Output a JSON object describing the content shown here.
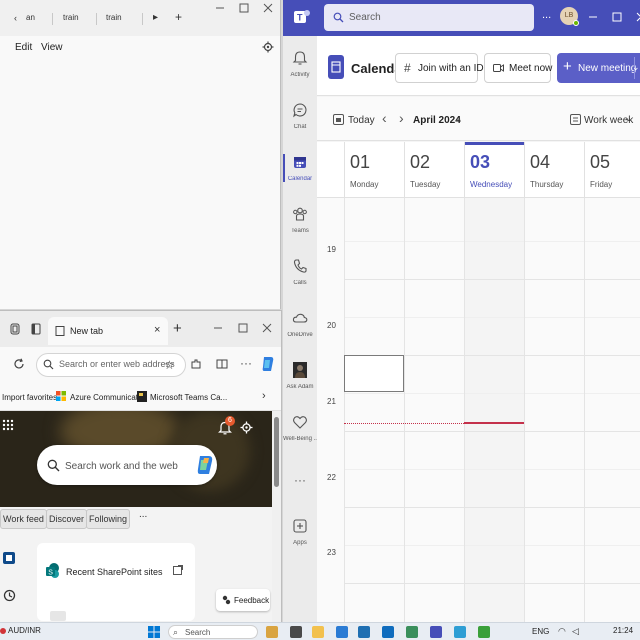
{
  "explorer_window": {
    "tabs": [
      {
        "label": "an",
        "icon": "chevron-left-icon"
      },
      {
        "label": "train"
      },
      {
        "label": "train"
      }
    ],
    "overflow_icon": "chevron-right-icon",
    "add_tab_icon": "plus-icon",
    "window_controls": [
      "minimize-icon",
      "maximize-icon",
      "close-icon"
    ],
    "menu": [
      "Edit",
      "View"
    ],
    "settings_icon": "gear-icon"
  },
  "browser_window": {
    "tab_label": "New tab",
    "address_placeholder": "Search or enter web address",
    "favorites": [
      "Import favorites",
      "Azure Communicati...",
      "Microsoft Teams Ca..."
    ],
    "notification_count": "6",
    "search_placeholder": "Search work and the web",
    "feed_tabs": [
      "Work feed",
      "Discover",
      "Following"
    ],
    "more_label": "...",
    "card_title": "Recent SharePoint sites",
    "feedback_label": "Feedback"
  },
  "teams": {
    "search_placeholder": "Search",
    "more_label": "...",
    "avatar_initials": "LB",
    "rail": [
      {
        "label": "Activity",
        "icon": "bell-icon"
      },
      {
        "label": "Chat",
        "icon": "chat-icon"
      },
      {
        "label": "Calendar",
        "icon": "calendar-icon",
        "active": true
      },
      {
        "label": "Teams",
        "icon": "teams-icon"
      },
      {
        "label": "Calls",
        "icon": "phone-icon"
      },
      {
        "label": "OneDrive",
        "icon": "cloud-icon"
      },
      {
        "label": "Ask Adam",
        "icon": "person-icon"
      },
      {
        "label": "Well-Being ...",
        "icon": "heart-icon"
      },
      {
        "label": "...",
        "icon": "more-icon"
      },
      {
        "label": "Apps",
        "icon": "plus-box-icon"
      }
    ],
    "calendar_title": "Calendar",
    "join_label": "Join with an ID",
    "meet_label": "Meet now",
    "new_meeting_label": "New meeting",
    "today_label": "Today",
    "month_label": "April 2024",
    "view_label": "Work week",
    "days": [
      {
        "num": "01",
        "name": "Monday"
      },
      {
        "num": "02",
        "name": "Tuesday"
      },
      {
        "num": "03",
        "name": "Wednesday",
        "today": true
      },
      {
        "num": "04",
        "name": "Thursday"
      },
      {
        "num": "05",
        "name": "Friday"
      }
    ],
    "hours": [
      "19",
      "20",
      "21",
      "22",
      "23"
    ],
    "accent": "#464eb8",
    "now_color": "#c4314b"
  },
  "taskbar": {
    "left_label": "AUD/INR",
    "lang": "ENG",
    "time": "21:24",
    "search_label": "Search"
  }
}
